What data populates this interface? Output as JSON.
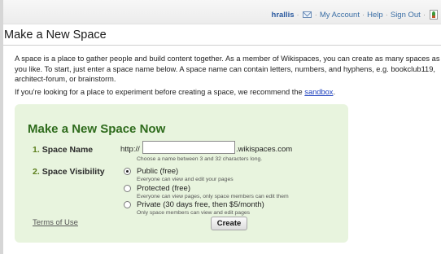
{
  "userbar": {
    "username": "hrallis",
    "my_account": "My Account",
    "help": "Help",
    "sign_out": "Sign Out",
    "separator": "·"
  },
  "page": {
    "title": "Make a New Space",
    "intro": "A space is a place to gather people and build content together. As a member of Wikispaces, you can create as many spaces as you like. To start, just enter a space name below. A space name can contain letters, numbers, and hyphens, e.g. bookclub119, architect-forum, or brainstorm.",
    "sandbox_prefix": "If you're looking for a place to experiment before creating a space, we recommend the ",
    "sandbox_link": "sandbox",
    "sandbox_suffix": "."
  },
  "form": {
    "heading": "Make a New Space Now",
    "step1_num": "1.",
    "step1_label": "Space Name",
    "url_prefix": "http://",
    "space_name_value": "",
    "url_suffix": ".wikispaces.com",
    "name_hint": "Choose a name between 3 and 32 characters long.",
    "step2_num": "2.",
    "step2_label": "Space Visibility",
    "options": [
      {
        "label": "Public (free)",
        "hint": "Everyone can view and edit your pages",
        "checked": true
      },
      {
        "label": "Protected (free)",
        "hint": "Everyone can view pages, only space members can edit them",
        "checked": false
      },
      {
        "label": "Private (30 days free, then $5/month)",
        "hint": "Only space members can view and edit pages",
        "checked": false
      }
    ],
    "terms_link": "Terms of Use",
    "create_button": "Create"
  },
  "icons": {
    "mail": "mail-icon",
    "plant": "plant-icon"
  },
  "colors": {
    "panel_bg": "#e8f4de",
    "heading_green": "#2e6b1c",
    "link_blue": "#3a6ea5",
    "username_blue": "#2b5aa0"
  }
}
